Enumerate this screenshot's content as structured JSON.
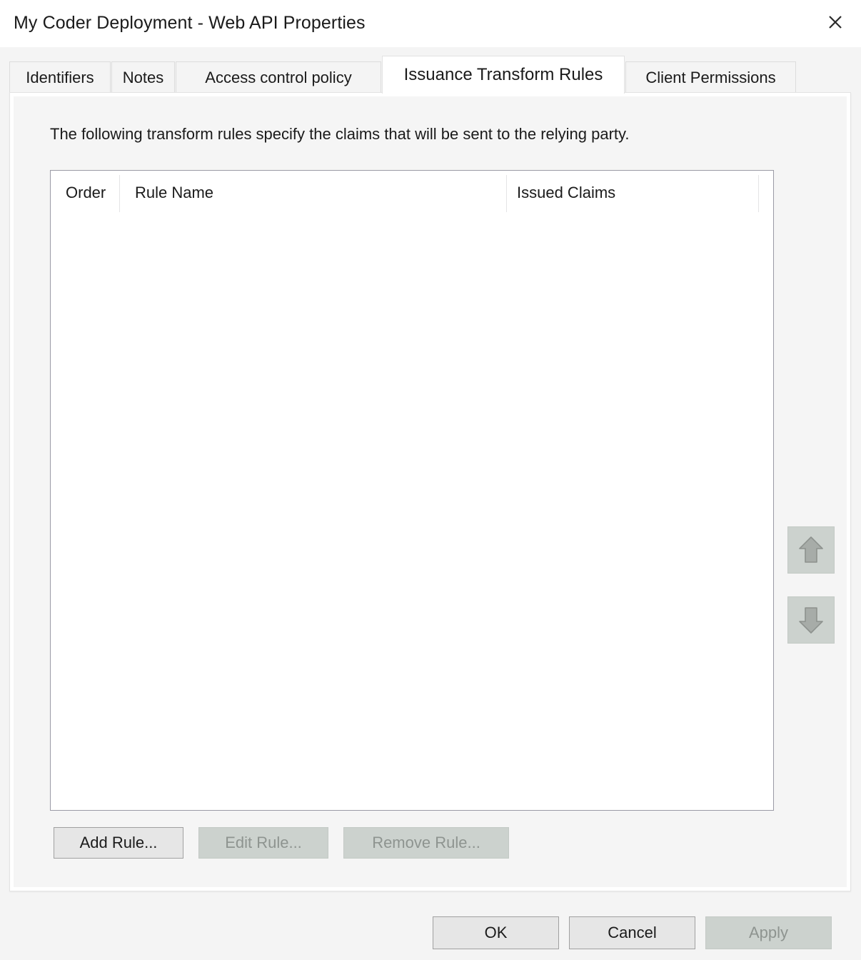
{
  "window": {
    "title": "My Coder Deployment - Web API Properties",
    "close_icon": "close-icon"
  },
  "tabs": [
    {
      "label": "Identifiers",
      "active": false
    },
    {
      "label": "Notes",
      "active": false
    },
    {
      "label": "Access control policy",
      "active": false
    },
    {
      "label": "Issuance Transform Rules",
      "active": true
    },
    {
      "label": "Client Permissions",
      "active": false
    }
  ],
  "panel": {
    "description": "The following transform rules specify the claims that will be sent to the relying party.",
    "list": {
      "columns": [
        {
          "label": "Order"
        },
        {
          "label": "Rule Name"
        },
        {
          "label": "Issued Claims"
        }
      ],
      "rows": []
    },
    "reorder": {
      "up_icon": "arrow-up-icon",
      "down_icon": "arrow-down-icon"
    },
    "buttons": [
      {
        "label": "Add Rule...",
        "enabled": true
      },
      {
        "label": "Edit Rule...",
        "enabled": false
      },
      {
        "label": "Remove Rule...",
        "enabled": false
      }
    ]
  },
  "footer": {
    "ok_label": "OK",
    "cancel_label": "Cancel",
    "apply_label": "Apply"
  },
  "colors": {
    "dialog_background": "#f4f4f4",
    "panel_background": "#f5f5f5",
    "titlebar_background": "#ffffff",
    "active_tab_background": "#ffffff",
    "inactive_tab_background": "#f4f4f4",
    "list_background": "#ffffff",
    "list_border": "#9a9aa5",
    "button_enabled_background": "#e6e6e6",
    "button_disabled_background": "#ccd2ce",
    "button_disabled_text": "#8e9490",
    "text": "#1a1a1a"
  }
}
